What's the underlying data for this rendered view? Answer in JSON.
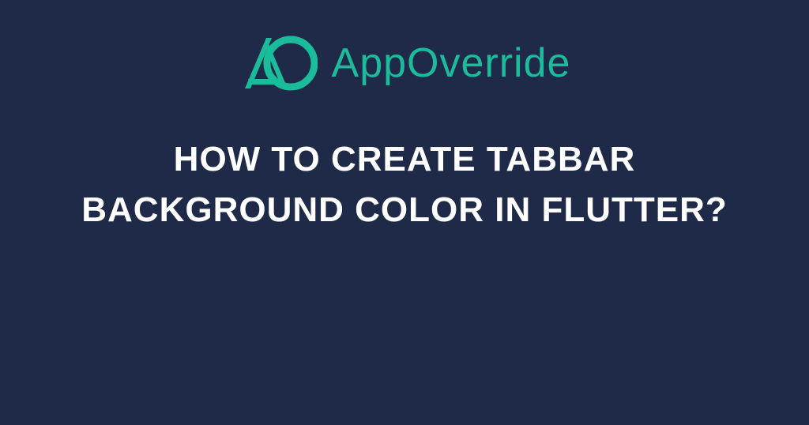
{
  "brand": {
    "name": "AppOverride",
    "accent_color": "#1abc9c"
  },
  "headline": "HOW TO CREATE TABBAR BACKGROUND COLOR IN FLUTTER?",
  "background_color": "#1e2a47",
  "text_color": "#ffffff"
}
